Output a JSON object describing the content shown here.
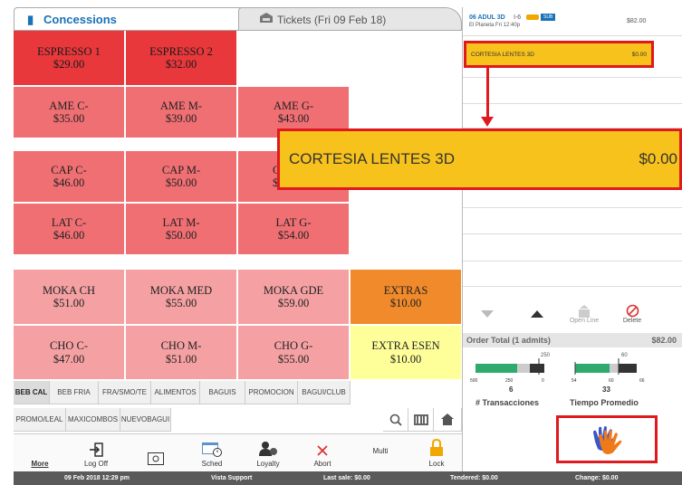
{
  "tabs": {
    "concessions": "Concessions",
    "tickets": "Tickets (Fri 09 Feb 18)"
  },
  "products": [
    {
      "name": "ESPRESSO 1",
      "price": "$29.00"
    },
    {
      "name": "ESPRESSO 2",
      "price": "$32.00"
    },
    {
      "name": "AME C-",
      "price": "$35.00"
    },
    {
      "name": "AME M-",
      "price": "$39.00"
    },
    {
      "name": "AME G-",
      "price": "$43.00"
    },
    {
      "name": "CAP C-",
      "price": "$46.00"
    },
    {
      "name": "CAP M-",
      "price": "$50.00"
    },
    {
      "name": "C",
      "price": "$"
    },
    {
      "name": "LAT C-",
      "price": "$46.00"
    },
    {
      "name": "LAT M-",
      "price": "$50.00"
    },
    {
      "name": "LAT G-",
      "price": "$54.00"
    },
    {
      "name": "MOKA CH",
      "price": "$51.00"
    },
    {
      "name": "MOKA MED",
      "price": "$55.00"
    },
    {
      "name": "MOKA GDE",
      "price": "$59.00"
    },
    {
      "name": "EXTRAS",
      "price": "$10.00"
    },
    {
      "name": "CHO C-",
      "price": "$47.00"
    },
    {
      "name": "CHO M-",
      "price": "$51.00"
    },
    {
      "name": "CHO G-",
      "price": "$55.00"
    },
    {
      "name": "EXTRA ESEN",
      "price": "$10.00"
    }
  ],
  "categories_row1": [
    "BEB CAL",
    "BEB FRIA",
    "FRA/SMO/TE",
    "ALIMENTOS",
    "BAGUIS",
    "PROMOCION",
    "BAGUI/CLUB"
  ],
  "categories_row2": [
    "PROMO/LEAL",
    "MAXICOMBOS",
    "NUEVOBAGUI"
  ],
  "toolbar": {
    "more": "More",
    "logoff": "Log Off",
    "sched": "Sched",
    "loyalty": "Loyalty",
    "abort": "Abort",
    "multi": "Multi",
    "lock": "Lock"
  },
  "status": {
    "datetime": "09 Feb 2018 12:29 pm",
    "support": "Vista Support",
    "last_sale": "Last sale: $0.00",
    "tendered": "Tendered: $0.00",
    "change": "Change: $0.00"
  },
  "order": {
    "ticket_title": "06 ADUL 3D",
    "ticket_rating": "I-6",
    "ticket_badge": "SUB",
    "ticket_sub": "El Planeta Fri 12:40p",
    "ticket_price": "$82.00",
    "item_name": "CORTESIA LENTES 3D",
    "item_price": "$0.00"
  },
  "controls": {
    "open_line": "Open Line",
    "delete": "Delete"
  },
  "totals": {
    "label": "Order Total (1 admits)",
    "value": "$82.00"
  },
  "gauges": {
    "left_marker": "250",
    "left_ticks": [
      "500",
      "250",
      "0"
    ],
    "left_value": "6",
    "left_label": "# Transacciones",
    "right_marker": "60",
    "right_ticks": [
      "54",
      "60",
      "66"
    ],
    "right_value": "33",
    "right_label": "Tiempo Promedio"
  },
  "colors": {
    "accent_blue": "#1a72b8",
    "highlight_red": "#e0191e",
    "highlight_yellow": "#f7c21b"
  }
}
